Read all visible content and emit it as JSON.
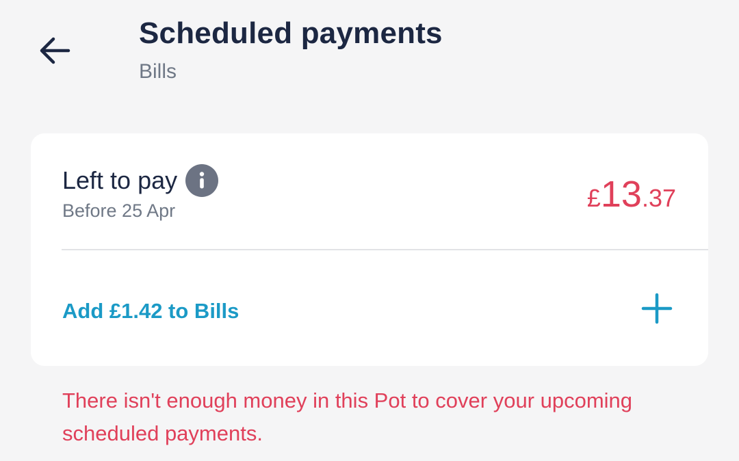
{
  "header": {
    "back_icon": "arrow-left-icon",
    "title": "Scheduled payments",
    "subtitle": "Bills"
  },
  "card": {
    "left_label": "Left to pay",
    "info_icon": "info-icon",
    "due_date": "Before 25 Apr",
    "amount": {
      "currency": "£",
      "major": "13",
      "minor": ".37"
    },
    "add_label": "Add £1.42 to Bills",
    "add_icon": "plus-icon"
  },
  "warning": "There isn't enough money in this Pot to cover your upcoming scheduled payments.",
  "colors": {
    "background": "#f5f5f6",
    "card": "#ffffff",
    "title": "#1c2742",
    "muted": "#6f7886",
    "negative": "#e0405a",
    "accent": "#1b9ac6",
    "info_icon": "#6c7383"
  }
}
